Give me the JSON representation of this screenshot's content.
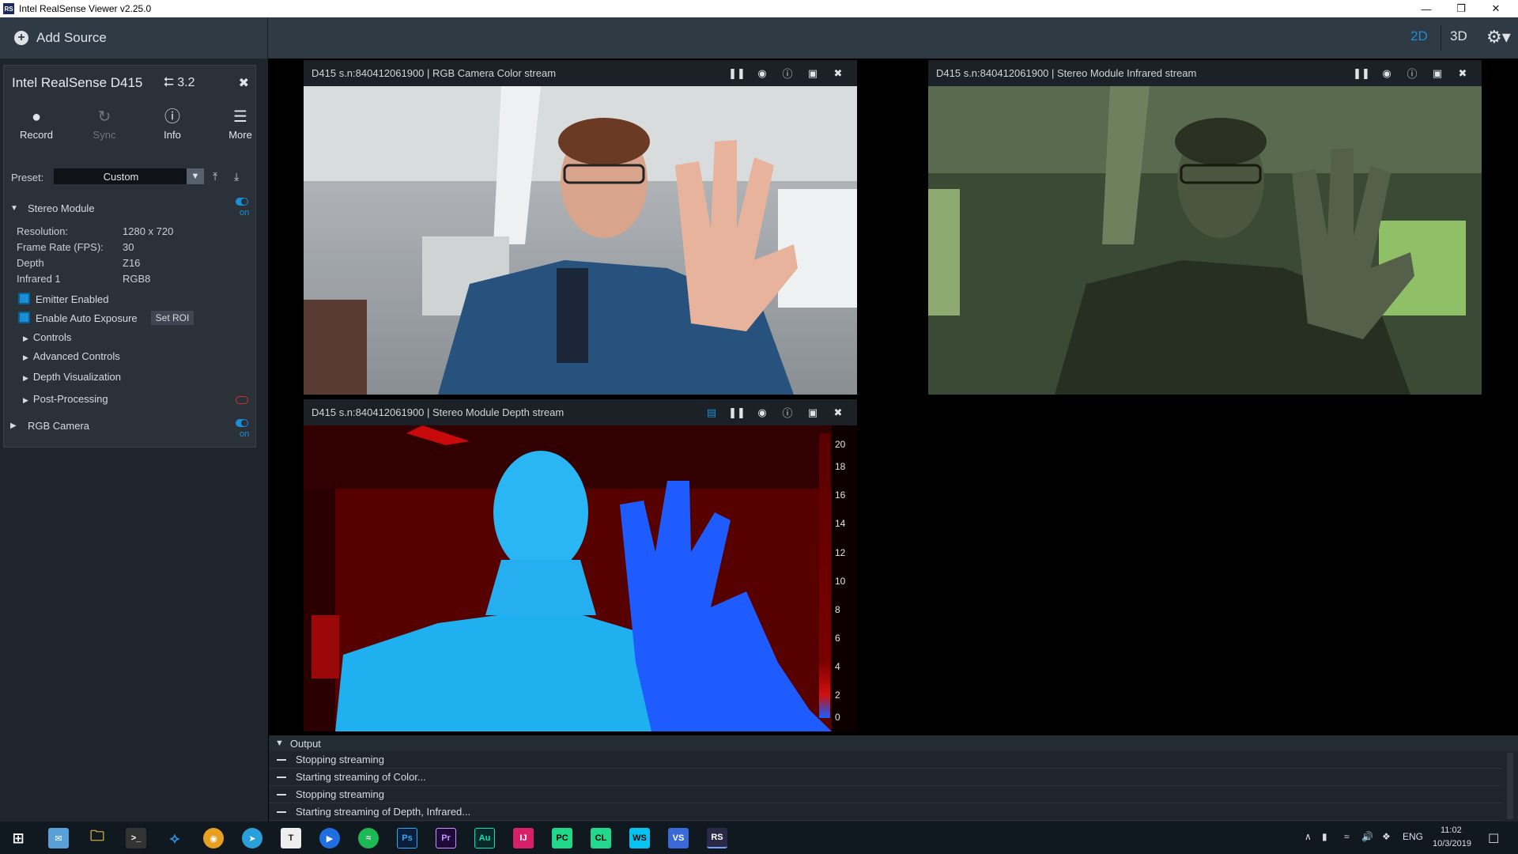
{
  "window": {
    "title": "Intel RealSense Viewer v2.25.0",
    "app_icon": "RS"
  },
  "topbar": {
    "add_source": "Add Source",
    "mode_2d": "2D",
    "mode_3d": "3D",
    "accent": "#1a8fd6"
  },
  "device": {
    "name": "Intel RealSense D415",
    "usb": "3.2",
    "tools": [
      {
        "label": "Record",
        "icon": "record-icon",
        "enabled": true
      },
      {
        "label": "Sync",
        "icon": "sync-icon",
        "enabled": false
      },
      {
        "label": "Info",
        "icon": "info-icon",
        "enabled": true
      },
      {
        "label": "More",
        "icon": "menu-icon",
        "enabled": true
      }
    ],
    "preset_label": "Preset:",
    "preset_value": "Custom",
    "stereo": {
      "title": "Stereo Module",
      "on": "on",
      "rows": [
        {
          "key": "Resolution:",
          "value": "1280 x 720"
        },
        {
          "key": "Frame Rate (FPS):",
          "value": "30"
        },
        {
          "key": "Depth",
          "value": "Z16"
        },
        {
          "key": "Infrared 1",
          "value": "RGB8"
        }
      ],
      "emitter": "Emitter Enabled",
      "auto_exposure": "Enable Auto Exposure",
      "set_roi": "Set ROI",
      "controls": "Controls",
      "advanced": "Advanced Controls",
      "depth_vis": "Depth Visualization",
      "post": "Post-Processing"
    },
    "rgb": {
      "title": "RGB Camera",
      "on": "on"
    }
  },
  "streams": {
    "color": {
      "title": "D415 s.n:840412061900 | RGB Camera Color stream"
    },
    "infrared": {
      "title": "D415 s.n:840412061900 | Stereo Module Infrared stream"
    },
    "depth": {
      "title": "D415 s.n:840412061900 | Stereo Module Depth stream",
      "scale": [
        "20",
        "18",
        "16",
        "14",
        "12",
        "10",
        "8",
        "6",
        "4",
        "2",
        "0"
      ]
    }
  },
  "output": {
    "title": "Output",
    "lines": [
      "Stopping streaming",
      "Starting streaming of Color...",
      "Stopping streaming",
      "Starting streaming of Depth, Infrared..."
    ]
  },
  "taskbar": {
    "lang": "ENG",
    "time": "11:02",
    "date": "10/3/2019",
    "apps": [
      "start",
      "mail",
      "explorer",
      "terminal",
      "vscode",
      "chrome",
      "telegram",
      "typora",
      "media",
      "spotify",
      "Ps",
      "Pr",
      "Au",
      "IJ",
      "PC",
      "CL",
      "WS",
      "VS",
      "RS"
    ]
  }
}
